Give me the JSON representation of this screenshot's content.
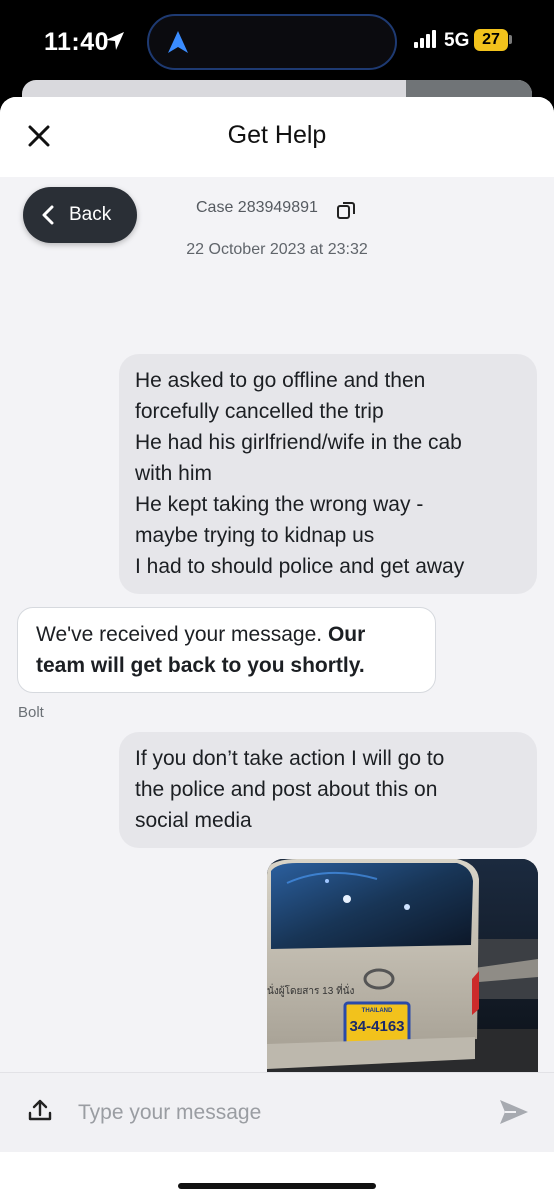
{
  "status_bar": {
    "time": "11:40",
    "network": "5G",
    "battery": "27",
    "island_icon": "navigation-arrow-icon",
    "location_icon": "location-arrow-icon"
  },
  "header": {
    "title": "Get Help",
    "close_icon": "close-icon"
  },
  "chat": {
    "back_label": "Back",
    "case_label": "Case 283949891",
    "date": "22 October 2023 at 23:32",
    "messages": [
      {
        "direction": "outgoing",
        "lines": [
          "He asked to go offline and then",
          "forcefully cancelled the trip",
          "He had his girlfriend/wife in the cab",
          "with him",
          "He kept taking the wrong way -",
          "maybe trying to kidnap us",
          "I had to should police and get away"
        ]
      },
      {
        "direction": "incoming",
        "text_plain": "We've received your message.",
        "text_bold_1": "Our",
        "text_bold_2": "team will get back to you shortly.",
        "sender": "Bolt"
      },
      {
        "direction": "outgoing",
        "lines": [
          "If you don’t take action I will go to",
          "the police and post about this on",
          "social media"
        ]
      }
    ],
    "photo": {
      "van_sign": "นั่งผู้โดยสาร 13 ที่นั่ง",
      "plate_top": "THAILAND",
      "plate_number": "34-4163"
    }
  },
  "composer": {
    "placeholder": "Type your message",
    "value": ""
  },
  "colors": {
    "bubble_outgoing": "#e6e6ea",
    "chat_background": "#f3f3f6",
    "back_button": "#2a2f36",
    "plate_yellow": "#f2c21c"
  }
}
